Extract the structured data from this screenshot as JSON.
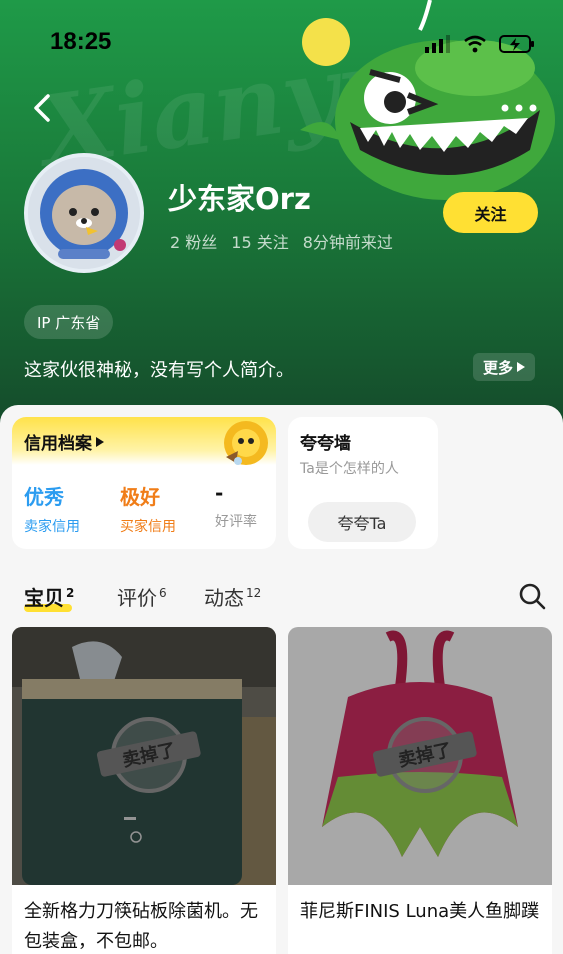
{
  "status_bar": {
    "time": "18:25"
  },
  "profile": {
    "username": "少东家Orz",
    "fans": "2 粉丝",
    "following": "15 关注",
    "last_seen": "8分钟前来过",
    "follow_label": "关注",
    "ip_location": "IP 广东省",
    "bio": "这家伙很神秘，没有写个人简介。",
    "more_label": "更多",
    "watermark": "Xianyu"
  },
  "credit": {
    "title": "信用档案",
    "items": [
      {
        "value": "优秀",
        "label": "卖家信用",
        "color": "#2b9cf0"
      },
      {
        "value": "极好",
        "label": "买家信用",
        "color": "#f07d18"
      },
      {
        "value": "-",
        "label": "好评率",
        "color": "#111111"
      }
    ]
  },
  "praise_wall": {
    "title": "夸夸墙",
    "subtitle": "Ta是个怎样的人",
    "button": "夸夸Ta"
  },
  "tabs": [
    {
      "label": "宝贝",
      "count": "2"
    },
    {
      "label": "评价",
      "count": "6"
    },
    {
      "label": "动态",
      "count": "12"
    }
  ],
  "items": [
    {
      "title": "全新格力刀筷砧板除菌机。无包装盒，不包邮。",
      "badge": "卖掉了"
    },
    {
      "title": "菲尼斯FINIS Luna美人鱼脚蹼",
      "badge": "卖掉了"
    }
  ],
  "colors": {
    "accent": "#ffe033",
    "header_green": "#1a7a3a"
  }
}
